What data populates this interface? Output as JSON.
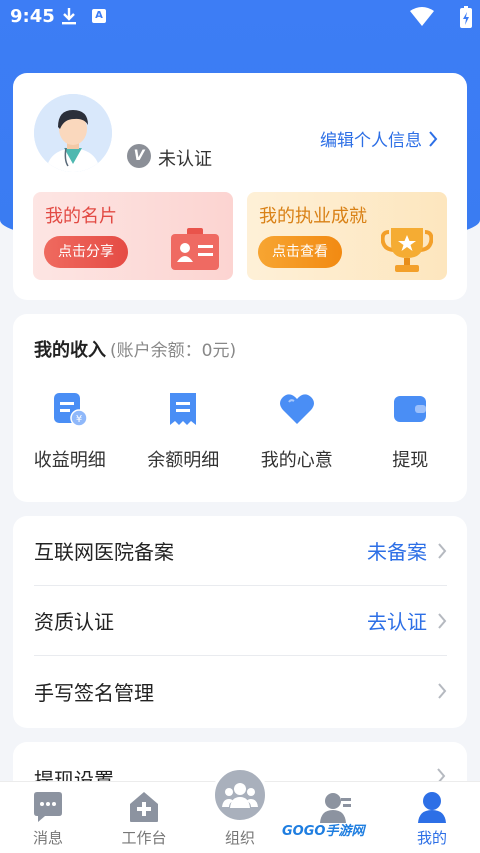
{
  "status_bar": {
    "time": "9:45",
    "a_label": "A"
  },
  "profile": {
    "verify_badge": "V",
    "auth_status": "未认证",
    "edit_link": "编辑个人信息",
    "card": {
      "title": "我的名片",
      "button": "点击分享"
    },
    "achievement": {
      "title": "我的执业成就",
      "button": "点击查看"
    }
  },
  "income": {
    "title": "我的收入",
    "balance": "(账户余额：0元)",
    "items": [
      {
        "label": "收益明细",
        "icon": "income-detail-icon"
      },
      {
        "label": "余额明细",
        "icon": "receipt-icon"
      },
      {
        "label": "我的心意",
        "icon": "heart-icon"
      },
      {
        "label": "提现",
        "icon": "wallet-icon"
      }
    ]
  },
  "list": [
    {
      "label": "互联网医院备案",
      "value": "未备案"
    },
    {
      "label": "资质认证",
      "value": "去认证"
    },
    {
      "label": "手写签名管理",
      "value": ""
    }
  ],
  "peek_row": {
    "label": "提现设置"
  },
  "nav": [
    {
      "label": "消息",
      "icon": "message-icon"
    },
    {
      "label": "工作台",
      "icon": "workbench-icon"
    },
    {
      "label": "组织",
      "icon": "organization-icon"
    },
    {
      "label": "",
      "icon": "patient-icon"
    },
    {
      "label": "我的",
      "icon": "profile-icon"
    }
  ],
  "watermark": "GOGO手游网",
  "colors": {
    "primary": "#3d7df5",
    "link": "#2d6fe6",
    "card_red": "#e24a43",
    "card_orange": "#d98116"
  }
}
